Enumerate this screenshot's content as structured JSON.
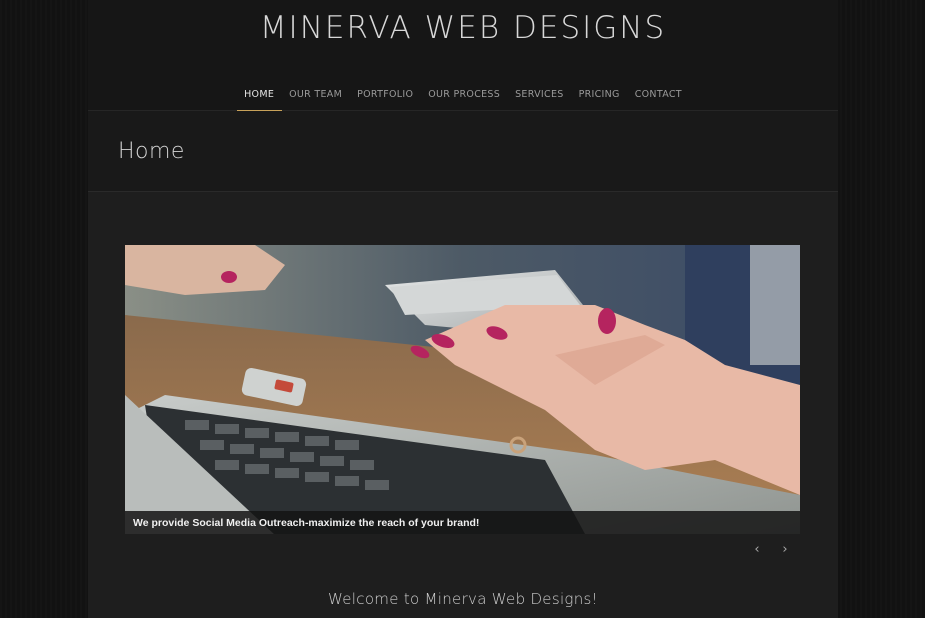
{
  "site": {
    "title": "MINERVA WEB DESIGNS"
  },
  "nav": {
    "items": [
      {
        "label": "HOME"
      },
      {
        "label": "OUR TEAM"
      },
      {
        "label": "PORTFOLIO"
      },
      {
        "label": "OUR PROCESS"
      },
      {
        "label": "SERVICES"
      },
      {
        "label": "PRICING"
      },
      {
        "label": "CONTACT"
      }
    ],
    "active_index": 0
  },
  "page": {
    "title": "Home"
  },
  "slider": {
    "caption": "We provide Social Media Outreach-maximize the reach of your brand!",
    "prev_icon": "‹",
    "next_icon": "›"
  },
  "welcome": {
    "heading": "Welcome to Minerva Web Designs!"
  },
  "colors": {
    "accent": "#c8a25a",
    "page_bg": "#1e1e1e",
    "header_bg": "#161616"
  }
}
